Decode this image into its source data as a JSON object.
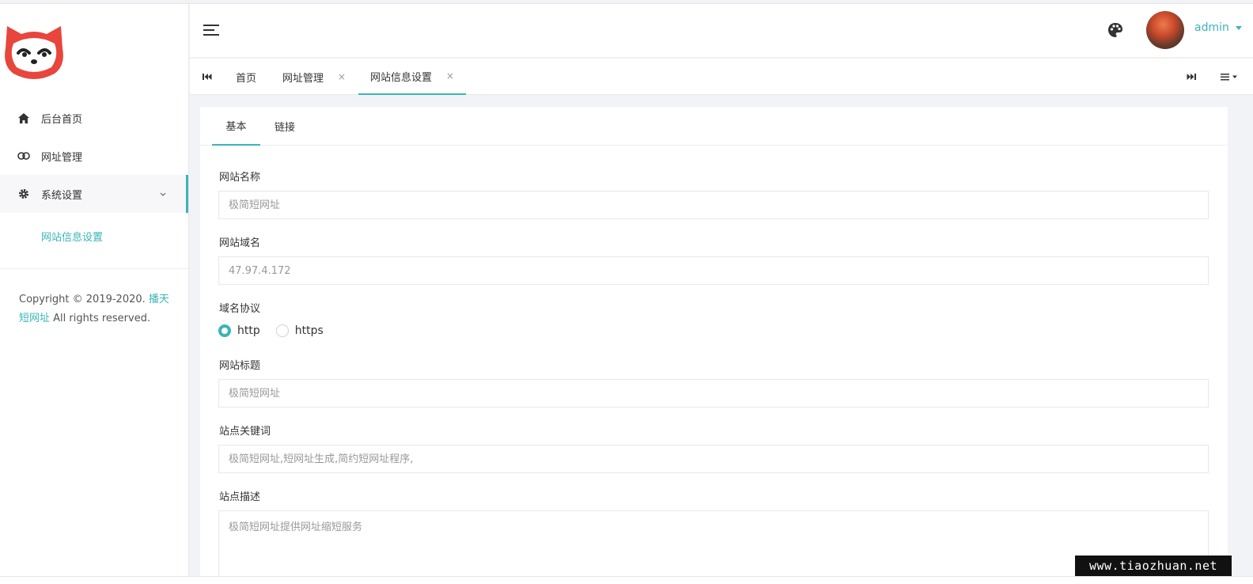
{
  "sidebar": {
    "items": [
      {
        "label": "后台首页",
        "icon": "home-icon"
      },
      {
        "label": "网址管理",
        "icon": "link-icon"
      },
      {
        "label": "系统设置",
        "icon": "gear-icon"
      }
    ],
    "submenu_active": "网站信息设置",
    "copyright_prefix": "Copyright © 2019-2020. ",
    "copyright_link": "播天短网址",
    "copyright_suffix": " All rights reserved."
  },
  "header": {
    "username": "admin"
  },
  "tabs": [
    {
      "label": "首页"
    },
    {
      "label": "网址管理",
      "close": "×"
    },
    {
      "label": "网站信息设置",
      "close": "×"
    }
  ],
  "subtabs": [
    {
      "label": "基本"
    },
    {
      "label": "链接"
    }
  ],
  "form": {
    "site_name_label": "网站名称",
    "site_name_placeholder": "极简短网址",
    "site_domain_label": "网站域名",
    "site_domain_placeholder": "47.97.4.172",
    "protocol_label": "域名协议",
    "protocol_options": [
      "http",
      "https"
    ],
    "protocol_selected": "http",
    "site_title_label": "网站标题",
    "site_title_placeholder": "极简短网址",
    "keywords_label": "站点关键词",
    "keywords_placeholder": "极简短网址,短网址生成,简约短网址程序,",
    "description_label": "站点描述",
    "description_placeholder": "极简短网址提供网址缩短服务"
  },
  "watermark": "www.tiaozhuan.net",
  "colors": {
    "accent": "#3bb4b7",
    "logo_red": "#e8453c"
  }
}
